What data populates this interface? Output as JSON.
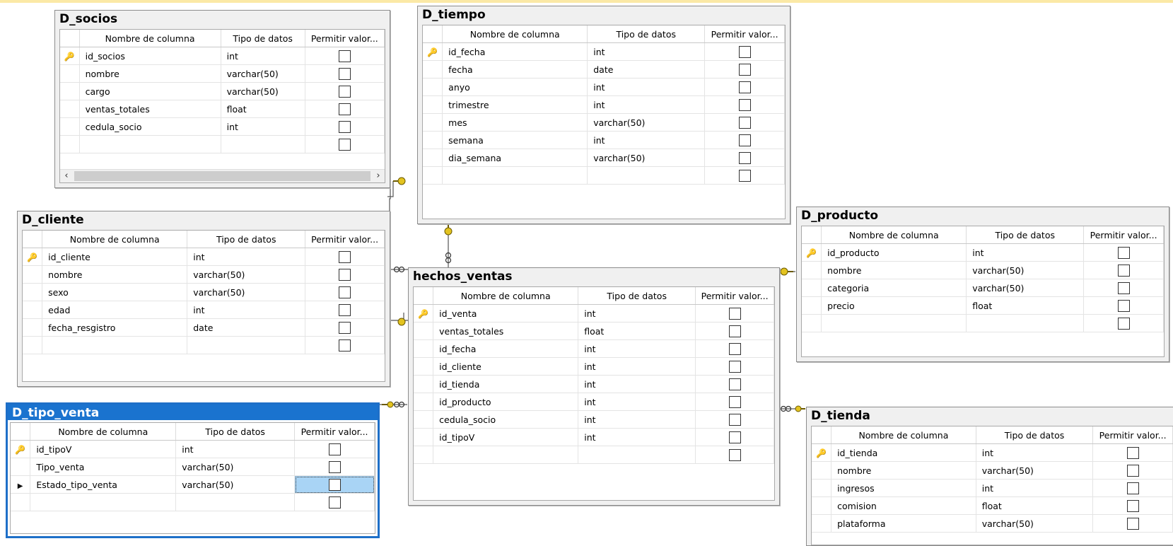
{
  "headers": {
    "name": "Nombre de columna",
    "type": "Tipo de datos",
    "nulls": "Permitir valor..."
  },
  "tables": {
    "socios": {
      "title": "D_socios",
      "rows": [
        {
          "name": "id_socios",
          "type": "int",
          "key": true
        },
        {
          "name": "nombre",
          "type": "varchar(50)"
        },
        {
          "name": "cargo",
          "type": "varchar(50)"
        },
        {
          "name": "ventas_totales",
          "type": "float"
        },
        {
          "name": "cedula_socio",
          "type": "int"
        },
        {
          "name": "",
          "type": ""
        }
      ]
    },
    "tiempo": {
      "title": "D_tiempo",
      "rows": [
        {
          "name": "id_fecha",
          "type": "int",
          "key": true
        },
        {
          "name": "fecha",
          "type": "date"
        },
        {
          "name": "anyo",
          "type": "int"
        },
        {
          "name": "trimestre",
          "type": "int"
        },
        {
          "name": "mes",
          "type": "varchar(50)"
        },
        {
          "name": "semana",
          "type": "int"
        },
        {
          "name": "dia_semana",
          "type": "varchar(50)"
        },
        {
          "name": "",
          "type": ""
        }
      ]
    },
    "cliente": {
      "title": "D_cliente",
      "rows": [
        {
          "name": "id_cliente",
          "type": "int",
          "key": true
        },
        {
          "name": "nombre",
          "type": "varchar(50)"
        },
        {
          "name": "sexo",
          "type": "varchar(50)"
        },
        {
          "name": "edad",
          "type": "int"
        },
        {
          "name": "fecha_resgistro",
          "type": "date"
        },
        {
          "name": "",
          "type": ""
        }
      ]
    },
    "producto": {
      "title": "D_producto",
      "rows": [
        {
          "name": "id_producto",
          "type": "int",
          "key": true
        },
        {
          "name": "nombre",
          "type": "varchar(50)"
        },
        {
          "name": "categoria",
          "type": "varchar(50)"
        },
        {
          "name": "precio",
          "type": "float"
        },
        {
          "name": "",
          "type": ""
        }
      ]
    },
    "hechos": {
      "title": "hechos_ventas",
      "rows": [
        {
          "name": "id_venta",
          "type": "int",
          "key": true
        },
        {
          "name": "ventas_totales",
          "type": "float"
        },
        {
          "name": "id_fecha",
          "type": "int"
        },
        {
          "name": "id_cliente",
          "type": "int"
        },
        {
          "name": "id_tienda",
          "type": "int"
        },
        {
          "name": "id_producto",
          "type": "int"
        },
        {
          "name": "cedula_socio",
          "type": "int"
        },
        {
          "name": "id_tipoV",
          "type": "int"
        },
        {
          "name": "",
          "type": ""
        }
      ]
    },
    "tipo": {
      "title": "D_tipo_venta",
      "rows": [
        {
          "name": "id_tipoV",
          "type": "int",
          "key": true
        },
        {
          "name": "Tipo_venta",
          "type": "varchar(50)"
        },
        {
          "name": "Estado_tipo_venta",
          "type": "varchar(50)",
          "current": true
        },
        {
          "name": "",
          "type": ""
        }
      ]
    },
    "tienda": {
      "title": "D_tienda",
      "rows": [
        {
          "name": "id_tienda",
          "type": "int",
          "key": true
        },
        {
          "name": "nombre",
          "type": "varchar(50)"
        },
        {
          "name": "ingresos",
          "type": "int"
        },
        {
          "name": "comision",
          "type": "float"
        },
        {
          "name": "plataforma",
          "type": "varchar(50)"
        }
      ]
    }
  }
}
